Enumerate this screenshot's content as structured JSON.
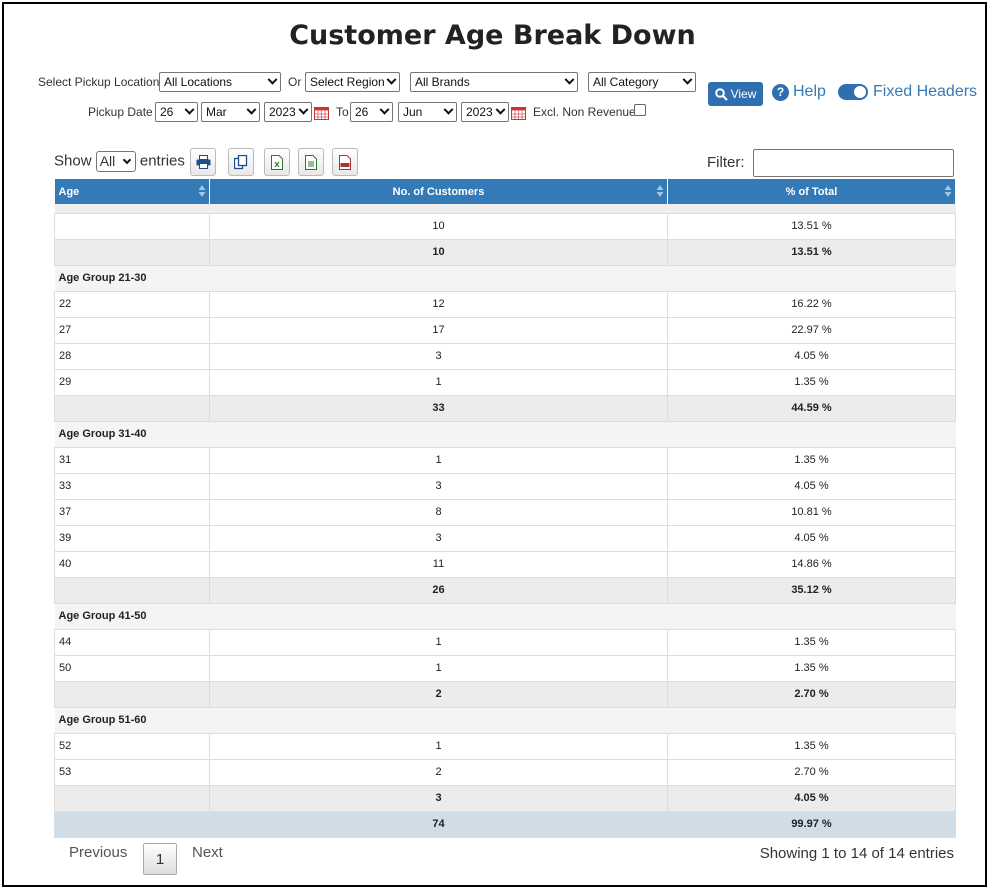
{
  "title": "Customer Age Break Down",
  "filters": {
    "pickup_location_label": "Select Pickup Location",
    "location_value": "All Locations",
    "or_label": "Or",
    "region_value": "Select Region",
    "brand_value": "All Brands",
    "category_value": "All Category",
    "pickup_date_label": "Pickup Date",
    "from_day": "26",
    "from_month": "Mar",
    "from_year": "2023",
    "to_label": "To",
    "to_day": "26",
    "to_month": "Jun",
    "to_year": "2023",
    "excl_label": "Excl. Non Revenue"
  },
  "actions": {
    "view_label": "View",
    "help_label": "Help",
    "fixed_headers_label": "Fixed Headers"
  },
  "table_controls": {
    "show_label": "Show",
    "entries_value": "All",
    "entries_label": "entries",
    "filter_label": "Filter:"
  },
  "columns": [
    "Age",
    "No. of Customers",
    "% of Total"
  ],
  "rows": {
    "r0": {
      "age": "",
      "count": "10",
      "pct": "13.51 %"
    },
    "s0": {
      "count": "10",
      "pct": "13.51 %"
    },
    "g1": "Age Group 21-30",
    "r1": {
      "age": "22",
      "count": "12",
      "pct": "16.22 %"
    },
    "r2": {
      "age": "27",
      "count": "17",
      "pct": "22.97 %"
    },
    "r3": {
      "age": "28",
      "count": "3",
      "pct": "4.05 %"
    },
    "r4": {
      "age": "29",
      "count": "1",
      "pct": "1.35 %"
    },
    "s1": {
      "count": "33",
      "pct": "44.59 %"
    },
    "g2": "Age Group 31-40",
    "r5": {
      "age": "31",
      "count": "1",
      "pct": "1.35 %"
    },
    "r6": {
      "age": "33",
      "count": "3",
      "pct": "4.05 %"
    },
    "r7": {
      "age": "37",
      "count": "8",
      "pct": "10.81 %"
    },
    "r8": {
      "age": "39",
      "count": "3",
      "pct": "4.05 %"
    },
    "r9": {
      "age": "40",
      "count": "11",
      "pct": "14.86 %"
    },
    "s2": {
      "count": "26",
      "pct": "35.12 %"
    },
    "g3": "Age Group 41-50",
    "r10": {
      "age": "44",
      "count": "1",
      "pct": "1.35 %"
    },
    "r11": {
      "age": "50",
      "count": "1",
      "pct": "1.35 %"
    },
    "s3": {
      "count": "2",
      "pct": "2.70 %"
    },
    "g4": "Age Group 51-60",
    "r12": {
      "age": "52",
      "count": "1",
      "pct": "1.35 %"
    },
    "r13": {
      "age": "53",
      "count": "2",
      "pct": "2.70 %"
    },
    "s4": {
      "count": "3",
      "pct": "4.05 %"
    },
    "total": {
      "count": "74",
      "pct": "99.97 %"
    }
  },
  "pagination": {
    "previous_label": "Previous",
    "page": "1",
    "next_label": "Next",
    "info": "Showing 1 to 14 of 14 entries"
  },
  "colors": {
    "header_blue": "#337ab7",
    "button_blue": "#2f6fb0",
    "total_row": "#d1dde6",
    "subtotal_row": "#ececec"
  }
}
